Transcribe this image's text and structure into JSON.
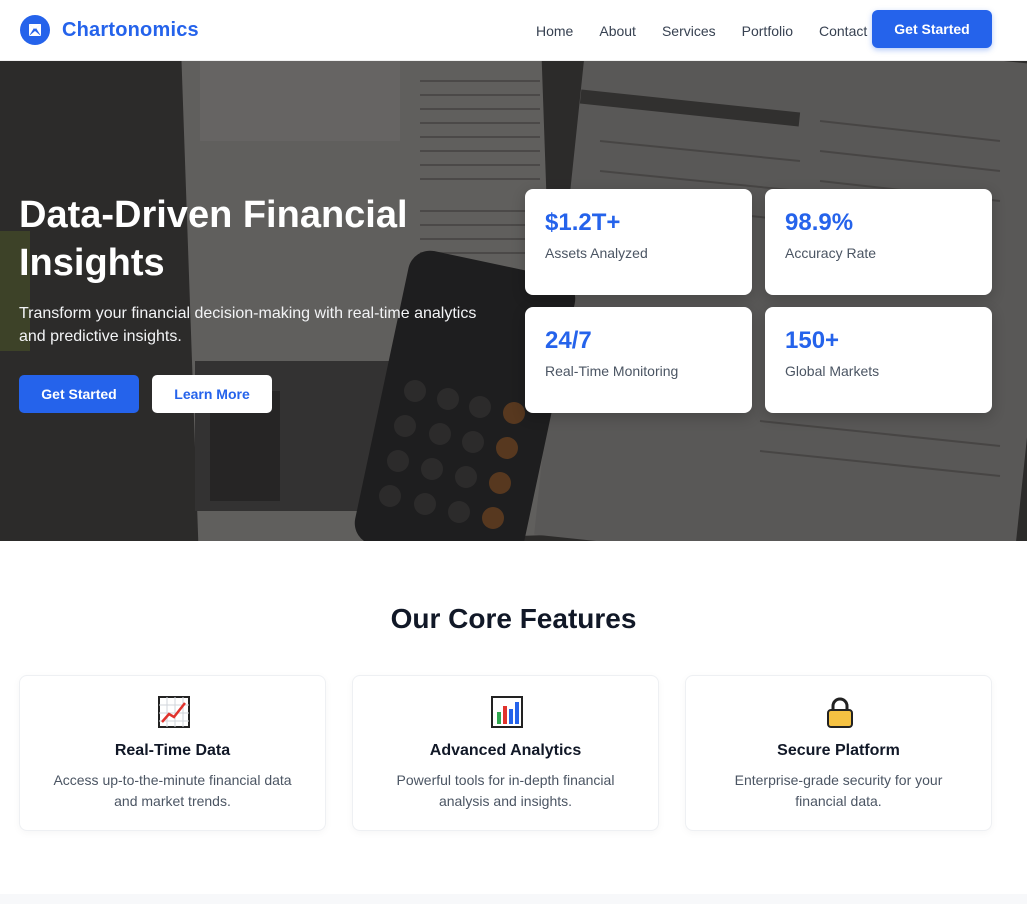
{
  "brand": {
    "name": "Chartonomics",
    "accent": "#2563eb"
  },
  "nav": {
    "links": [
      "Home",
      "About",
      "Services",
      "Portfolio",
      "Contact"
    ],
    "cta_label": "Get Started"
  },
  "hero": {
    "title": "Data-Driven Financial Insights",
    "subtitle": "Transform your financial decision-making with real-time analytics and predictive insights.",
    "primary_button": "Get Started",
    "secondary_button": "Learn More",
    "stats": [
      {
        "value": "$1.2T+",
        "label": "Assets Analyzed"
      },
      {
        "value": "98.9%",
        "label": "Accuracy Rate"
      },
      {
        "value": "24/7",
        "label": "Real-Time Monitoring"
      },
      {
        "value": "150+",
        "label": "Global Markets"
      }
    ]
  },
  "features": {
    "title": "Our Core Features",
    "items": [
      {
        "icon": "chart-increasing-icon",
        "title": "Real-Time Data",
        "description": "Access up-to-the-minute financial data and market trends."
      },
      {
        "icon": "bar-chart-icon",
        "title": "Advanced Analytics",
        "description": "Powerful tools for in-depth financial analysis and insights."
      },
      {
        "icon": "lock-icon",
        "title": "Secure Platform",
        "description": "Enterprise-grade security for your financial data."
      }
    ]
  }
}
